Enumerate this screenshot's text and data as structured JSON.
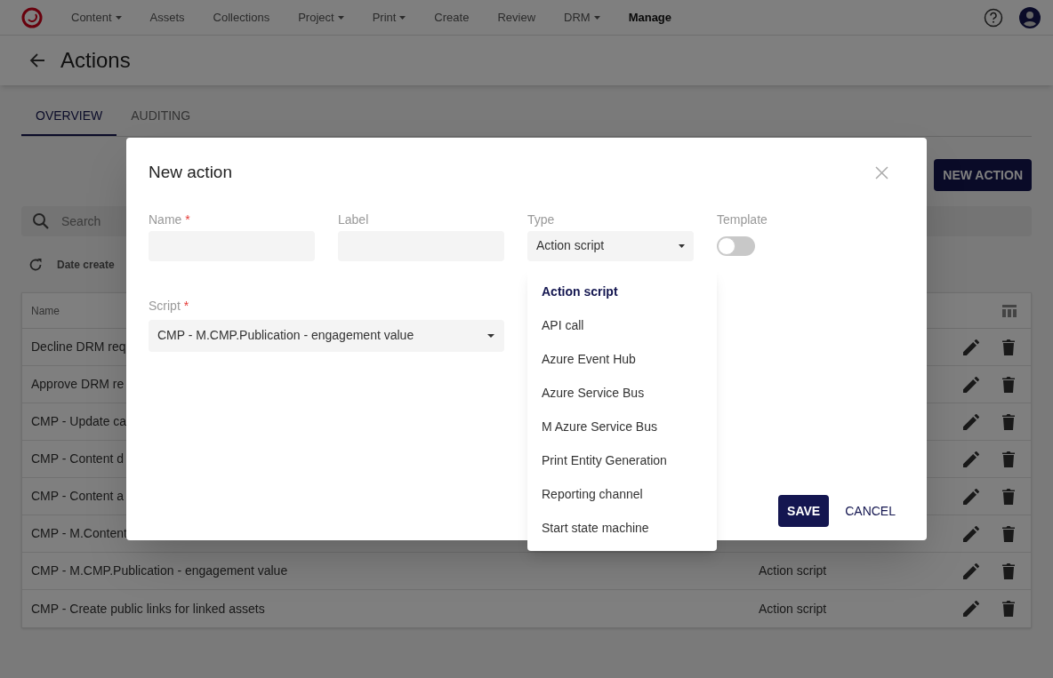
{
  "nav": {
    "items": [
      {
        "label": "Content",
        "dropdown": true,
        "selected": false
      },
      {
        "label": "Assets",
        "dropdown": false,
        "selected": false
      },
      {
        "label": "Collections",
        "dropdown": false,
        "selected": false
      },
      {
        "label": "Project",
        "dropdown": true,
        "selected": false
      },
      {
        "label": "Print",
        "dropdown": true,
        "selected": false
      },
      {
        "label": "Create",
        "dropdown": false,
        "selected": false
      },
      {
        "label": "Review",
        "dropdown": false,
        "selected": false
      },
      {
        "label": "DRM",
        "dropdown": true,
        "selected": false
      },
      {
        "label": "Manage",
        "dropdown": false,
        "selected": true
      }
    ]
  },
  "page": {
    "title": "Actions"
  },
  "tabs": [
    {
      "label": "OVERVIEW",
      "selected": true
    },
    {
      "label": "AUDITING",
      "selected": false
    }
  ],
  "new_action_button": "NEW ACTION",
  "search": {
    "placeholder": "Search"
  },
  "sort": {
    "label": "Date create"
  },
  "table": {
    "columns": [
      "Name"
    ],
    "rows": [
      {
        "name": "Decline DRM req"
      },
      {
        "name": "Approve DRM re"
      },
      {
        "name": "CMP - Update ca"
      },
      {
        "name": "CMP - Content d"
      },
      {
        "name": "CMP - Content a"
      },
      {
        "name": "CMP - M.Content"
      },
      {
        "name": "CMP - M.CMP.Publication - engagement value",
        "type": "Action script"
      },
      {
        "name": "CMP - Create public links for linked assets",
        "type": "Action script"
      }
    ]
  },
  "dialog": {
    "title": "New action",
    "fields": [
      {
        "kind": "text",
        "label": "Name",
        "required_mark": "*"
      },
      {
        "kind": "text",
        "label": "Label"
      },
      {
        "kind": "select",
        "label": "Type",
        "value": "Action script"
      },
      {
        "kind": "toggle",
        "label": "Template",
        "on": false
      }
    ],
    "script": {
      "label": "Script",
      "required_mark": "*",
      "value": "CMP - M.CMP.Publication - engagement value"
    },
    "buttons": [
      "SAVE",
      "CANCEL"
    ]
  },
  "type_dropdown": {
    "options": [
      {
        "label": "Action script",
        "selected": true
      },
      {
        "label": "API call",
        "selected": false
      },
      {
        "label": "Azure Event Hub",
        "selected": false
      },
      {
        "label": "Azure Service Bus",
        "selected": false
      },
      {
        "label": "M Azure Service Bus",
        "selected": false
      },
      {
        "label": "Print Entity Generation",
        "selected": false
      },
      {
        "label": "Reporting channel",
        "selected": false
      },
      {
        "label": "Start state machine",
        "selected": false
      }
    ]
  }
}
